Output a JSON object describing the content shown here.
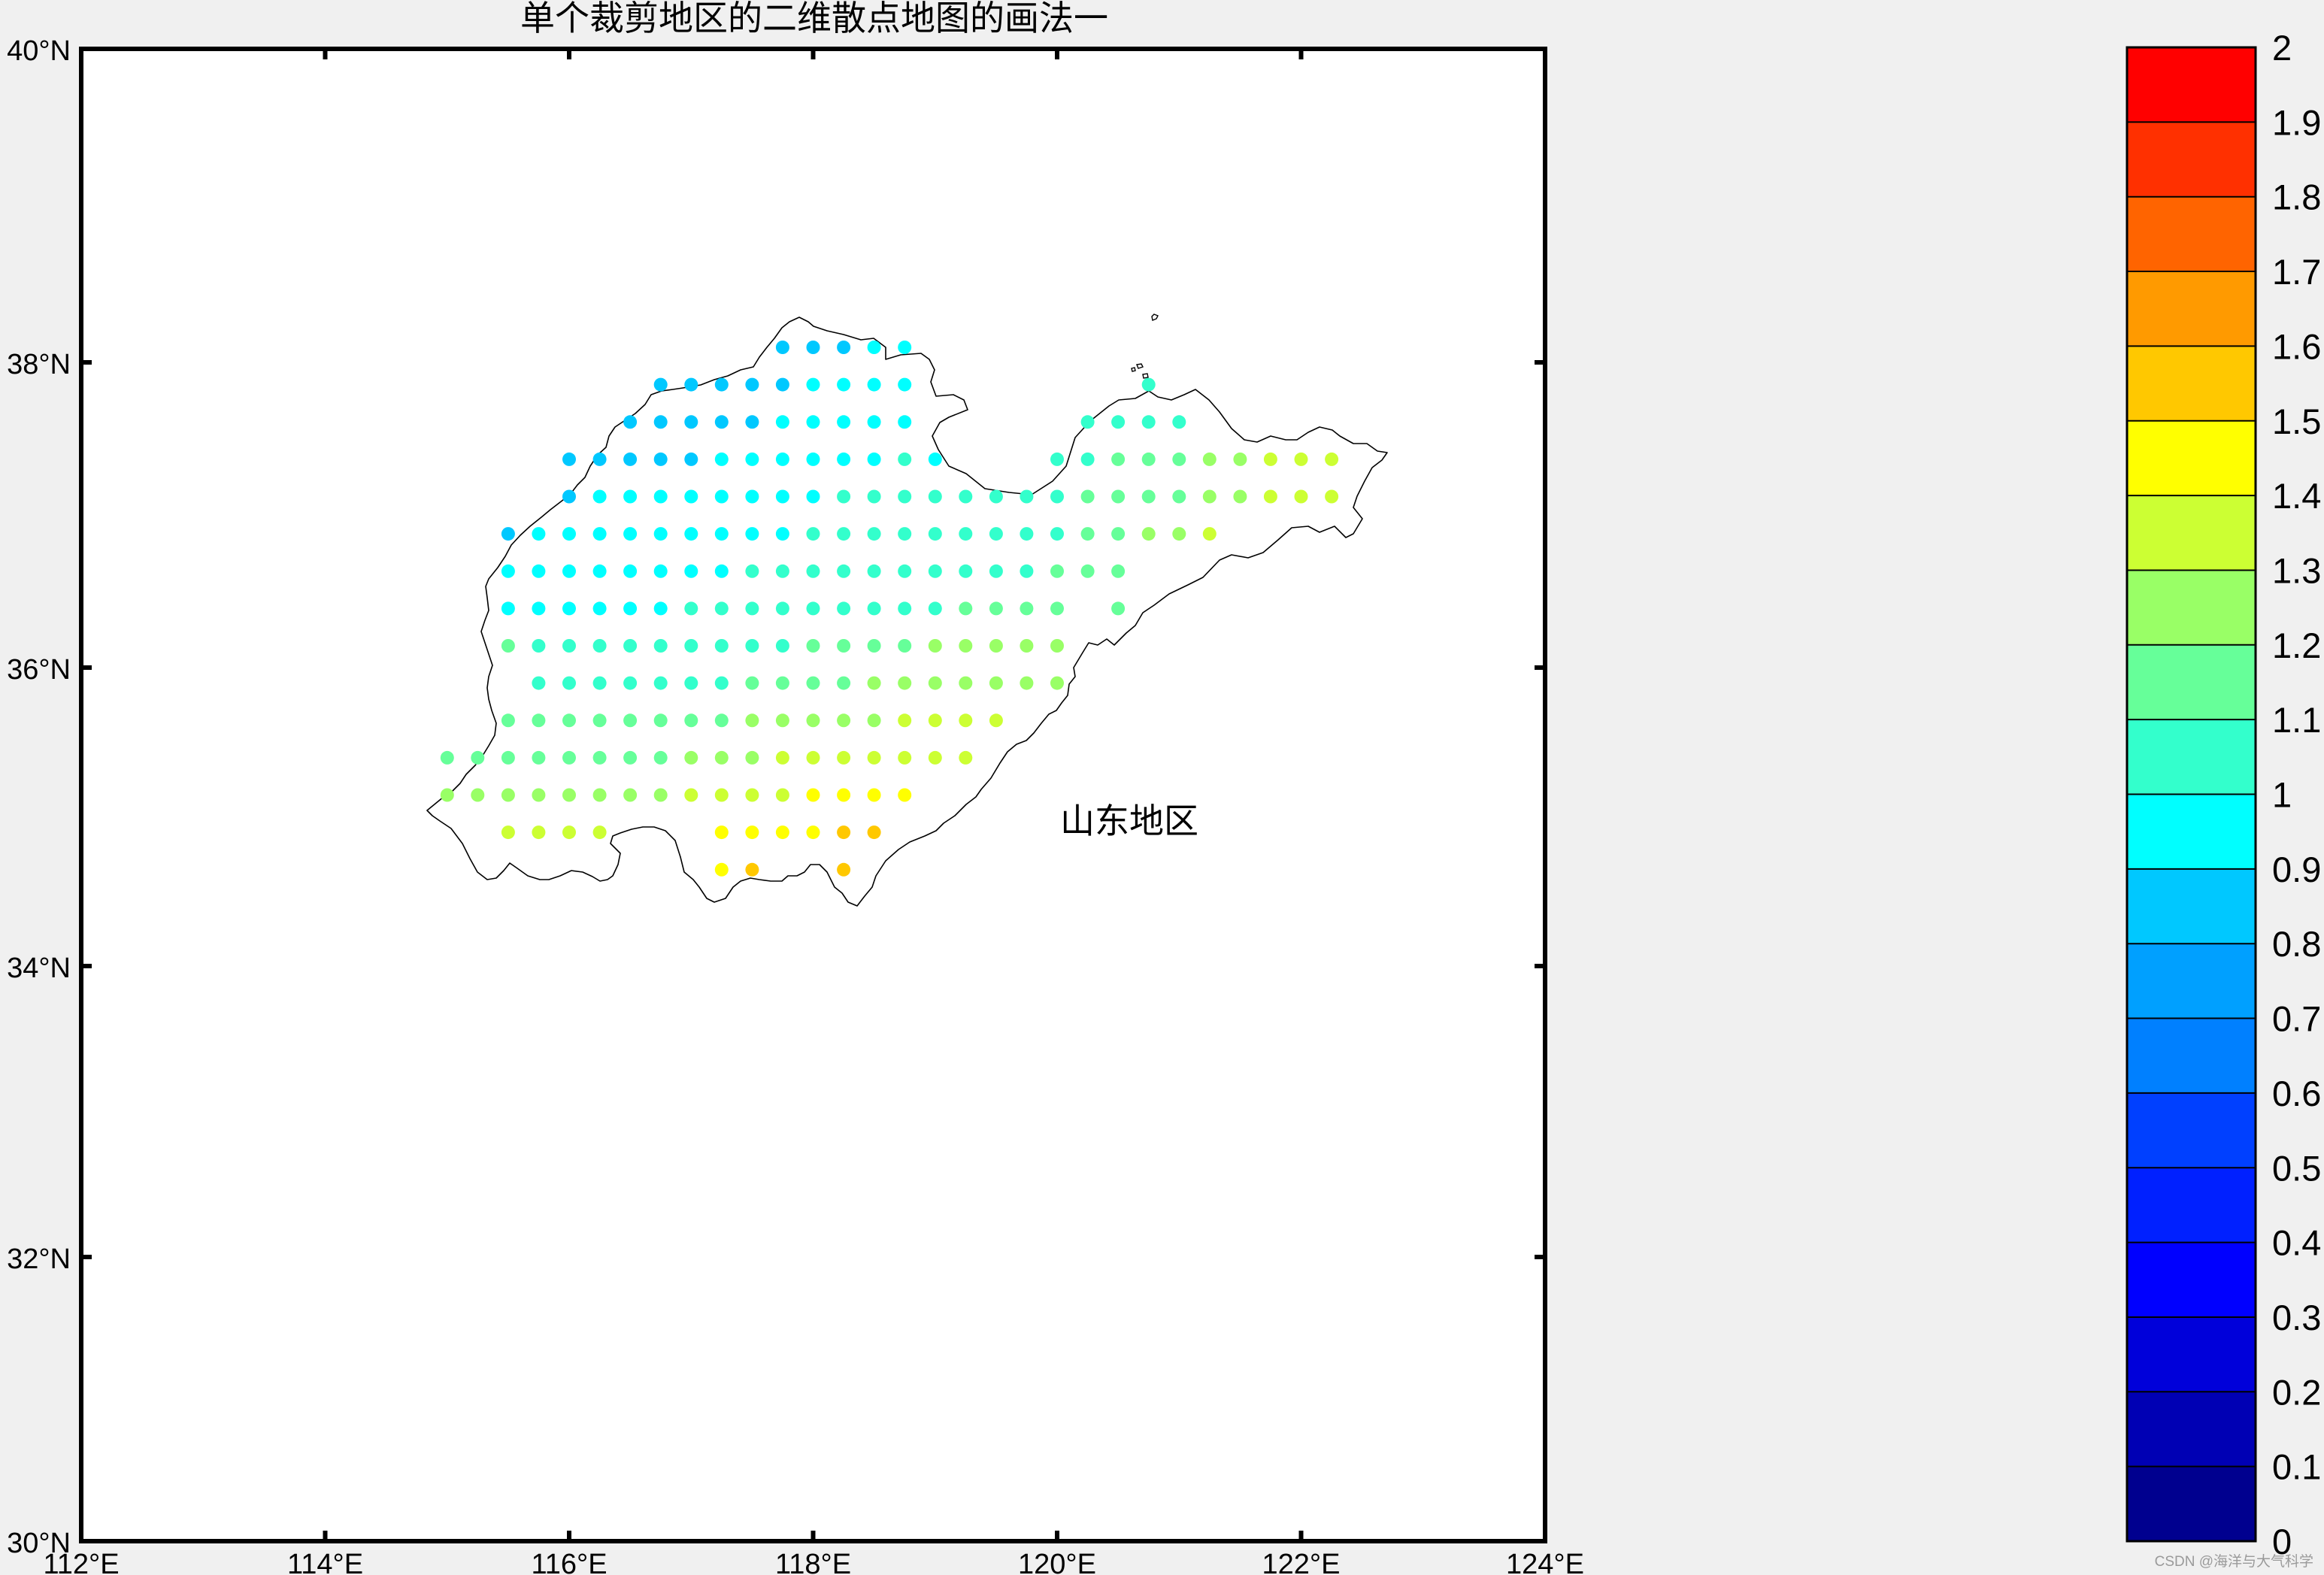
{
  "title": "单个裁剪地区的二维散点地图的画法一",
  "region_label": "山东地区",
  "map": {
    "lon_range": [
      112,
      124
    ],
    "lat_range": [
      30,
      40
    ],
    "lon_ticks": [
      "112°E",
      "114°E",
      "116°E",
      "118°E",
      "120°E",
      "122°E",
      "124°E"
    ],
    "lat_ticks": [
      "30°N",
      "32°N",
      "34°N",
      "36°N",
      "38°N",
      "40°N"
    ],
    "region": "山东"
  },
  "colorbar": {
    "range": [
      0,
      2
    ],
    "step": 0.1,
    "tick_labels": [
      "0",
      "0.1",
      "0.2",
      "0.3",
      "0.4",
      "0.5",
      "0.6",
      "0.7",
      "0.8",
      "0.9",
      "1",
      "1.1",
      "1.2",
      "1.3",
      "1.4",
      "1.5",
      "1.6",
      "1.7",
      "1.8",
      "1.9",
      "2"
    ],
    "colors": [
      "#00008f",
      "#0000b4",
      "#0000da",
      "#0000ff",
      "#0020ff",
      "#0040ff",
      "#0080ff",
      "#00a0ff",
      "#00c8ff",
      "#00ffff",
      "#33ffcc",
      "#66ff99",
      "#99ff66",
      "#ccff33",
      "#ffff00",
      "#ffc800",
      "#ff9a00",
      "#ff6400",
      "#ff3000",
      "#ff0000",
      "#cc0000",
      "#960000"
    ]
  },
  "chart_data": {
    "type": "scatter",
    "title": "单个裁剪地区的二维散点地图的画法一",
    "xlabel": "",
    "ylabel": "",
    "xlim": [
      112,
      124
    ],
    "ylim": [
      30,
      40
    ],
    "grid": false,
    "colorbar_range": [
      0,
      2
    ],
    "rows": [
      {
        "lat": 38.0,
        "lons": [
          117.75,
          118.0,
          118.25,
          118.5,
          118.75
        ],
        "values": [
          0.85,
          0.87,
          0.89,
          0.91,
          0.95
        ]
      },
      {
        "lat": 37.75,
        "lons": [
          116.75,
          117.0,
          117.25,
          117.5,
          117.75,
          118.0,
          118.25,
          118.5,
          118.75,
          120.75
        ],
        "values": [
          0.85,
          0.85,
          0.86,
          0.87,
          0.88,
          0.9,
          0.92,
          0.94,
          0.96,
          1.05
        ]
      },
      {
        "lat": 37.5,
        "lons": [
          116.5,
          116.75,
          117.0,
          117.25,
          117.5,
          117.75,
          118.0,
          118.25,
          118.5,
          118.75,
          120.25,
          120.5,
          120.75,
          121.0
        ],
        "values": [
          0.85,
          0.85,
          0.86,
          0.87,
          0.88,
          0.9,
          0.92,
          0.94,
          0.96,
          0.98,
          1.05,
          1.05,
          1.05,
          1.08
        ]
      },
      {
        "lat": 37.25,
        "lons": [
          116.0,
          116.25,
          116.5,
          116.75,
          117.0,
          117.25,
          117.5,
          117.75,
          118.0,
          118.25,
          118.5,
          118.75,
          119.0,
          120.0,
          120.25,
          120.5,
          120.75,
          121.0,
          121.25,
          121.5,
          121.75,
          122.0,
          122.25
        ],
        "values": [
          0.85,
          0.86,
          0.87,
          0.88,
          0.89,
          0.9,
          0.91,
          0.93,
          0.95,
          0.97,
          0.98,
          1.0,
          0.9,
          1.05,
          1.08,
          1.12,
          1.15,
          1.18,
          1.22,
          1.25,
          1.32,
          1.34,
          1.36
        ]
      },
      {
        "lat": 37.0,
        "lons": [
          116.0,
          116.25,
          116.5,
          116.75,
          117.0,
          117.25,
          117.5,
          117.75,
          118.0,
          118.25,
          118.5,
          118.75,
          119.0,
          119.25,
          119.5,
          119.75,
          120.0,
          120.25,
          120.5,
          120.75,
          121.0,
          121.25,
          121.5,
          121.75,
          122.0,
          122.25
        ],
        "values": [
          0.88,
          0.9,
          0.92,
          0.93,
          0.95,
          0.96,
          0.97,
          0.98,
          0.99,
          1.0,
          1.0,
          1.01,
          1.02,
          1.03,
          1.04,
          1.05,
          1.07,
          1.1,
          1.12,
          1.15,
          1.18,
          1.2,
          1.25,
          1.3,
          1.32,
          1.36
        ]
      },
      {
        "lat": 36.75,
        "lons": [
          115.5,
          115.75,
          116.0,
          116.25,
          116.5,
          116.75,
          117.0,
          117.25,
          117.5,
          117.75,
          118.0,
          118.25,
          118.5,
          118.75,
          119.0,
          119.25,
          119.5,
          119.75,
          120.0,
          120.25,
          120.5,
          120.75,
          121.0,
          121.25
        ],
        "values": [
          0.85,
          0.9,
          0.92,
          0.93,
          0.94,
          0.95,
          0.96,
          0.97,
          0.98,
          0.99,
          1.0,
          1.01,
          1.02,
          1.03,
          1.04,
          1.05,
          1.06,
          1.07,
          1.08,
          1.1,
          1.12,
          1.22,
          1.25,
          1.3
        ]
      },
      {
        "lat": 36.5,
        "lons": [
          115.5,
          115.75,
          116.0,
          116.25,
          116.5,
          116.75,
          117.0,
          117.25,
          117.5,
          117.75,
          118.0,
          118.25,
          118.5,
          118.75,
          119.0,
          119.25,
          119.5,
          119.75,
          120.0,
          120.25,
          120.5
        ],
        "values": [
          0.92,
          0.93,
          0.94,
          0.95,
          0.96,
          0.97,
          0.98,
          0.99,
          1.0,
          1.01,
          1.02,
          1.03,
          1.04,
          1.05,
          1.06,
          1.07,
          1.08,
          1.09,
          1.1,
          1.11,
          1.12
        ]
      },
      {
        "lat": 36.25,
        "lons": [
          115.5,
          115.75,
          116.0,
          116.25,
          116.5,
          116.75,
          117.0,
          117.25,
          117.5,
          117.75,
          118.0,
          118.25,
          118.5,
          118.75,
          119.0,
          119.25,
          119.5,
          119.75,
          120.0,
          120.5
        ],
        "values": [
          0.93,
          0.95,
          0.96,
          0.97,
          0.98,
          0.99,
          1.0,
          1.01,
          1.02,
          1.03,
          1.04,
          1.05,
          1.06,
          1.07,
          1.08,
          1.1,
          1.12,
          1.14,
          1.16,
          1.12
        ]
      },
      {
        "lat": 36.0,
        "lons": [
          115.5,
          115.75,
          116.0,
          116.25,
          116.5,
          116.75,
          117.0,
          117.25,
          117.5,
          117.75,
          118.0,
          118.25,
          118.5,
          118.75,
          119.0,
          119.25,
          119.5,
          119.75,
          120.0
        ],
        "values": [
          1.12,
          1.0,
          1.02,
          1.03,
          1.04,
          1.05,
          1.06,
          1.07,
          1.08,
          1.09,
          1.1,
          1.11,
          1.13,
          1.15,
          1.2,
          1.22,
          1.24,
          1.25,
          1.26
        ]
      },
      {
        "lat": 35.75,
        "lons": [
          115.75,
          116.0,
          116.25,
          116.5,
          116.75,
          117.0,
          117.25,
          117.5,
          117.75,
          118.0,
          118.25,
          118.5,
          118.75,
          119.0,
          119.25,
          119.5,
          119.75,
          120.0
        ],
        "values": [
          1.02,
          1.04,
          1.05,
          1.06,
          1.07,
          1.08,
          1.09,
          1.1,
          1.12,
          1.14,
          1.16,
          1.2,
          1.22,
          1.24,
          1.25,
          1.26,
          1.27,
          1.28
        ]
      },
      {
        "lat": 35.5,
        "lons": [
          115.5,
          115.75,
          116.0,
          116.25,
          116.5,
          116.75,
          117.0,
          117.25,
          117.5,
          117.75,
          118.0,
          118.25,
          118.5,
          118.75,
          119.0,
          119.25,
          119.5
        ],
        "values": [
          1.12,
          1.12,
          1.13,
          1.14,
          1.15,
          1.16,
          1.17,
          1.18,
          1.22,
          1.24,
          1.26,
          1.28,
          1.29,
          1.34,
          1.35,
          1.36,
          1.37
        ]
      },
      {
        "lat": 35.25,
        "lons": [
          115.0,
          115.25,
          115.5,
          115.75,
          116.0,
          116.25,
          116.5,
          116.75,
          117.0,
          117.25,
          117.5,
          117.75,
          118.0,
          118.25,
          118.5,
          118.75,
          119.0,
          119.25
        ],
        "values": [
          1.12,
          1.13,
          1.14,
          1.15,
          1.16,
          1.17,
          1.18,
          1.19,
          1.21,
          1.24,
          1.27,
          1.31,
          1.33,
          1.34,
          1.35,
          1.36,
          1.37,
          1.38
        ]
      },
      {
        "lat": 35.0,
        "lons": [
          115.0,
          115.25,
          115.5,
          115.75,
          116.0,
          116.25,
          116.5,
          116.75,
          117.0,
          117.25,
          117.5,
          117.75,
          118.0,
          118.25,
          118.5,
          118.75
        ],
        "values": [
          1.22,
          1.23,
          1.24,
          1.25,
          1.26,
          1.27,
          1.28,
          1.29,
          1.3,
          1.34,
          1.36,
          1.38,
          1.4,
          1.41,
          1.42,
          1.43
        ]
      },
      {
        "lat": 34.75,
        "lons": [
          115.5,
          115.75,
          116.0,
          116.25,
          117.25,
          117.5,
          117.75,
          118.0,
          118.25,
          118.5
        ],
        "values": [
          1.34,
          1.35,
          1.36,
          1.37,
          1.42,
          1.44,
          1.46,
          1.48,
          1.52,
          1.55
        ]
      },
      {
        "lat": 34.5,
        "lons": [
          117.25,
          117.5,
          118.25
        ],
        "values": [
          1.45,
          1.55,
          1.55
        ]
      }
    ]
  }
}
